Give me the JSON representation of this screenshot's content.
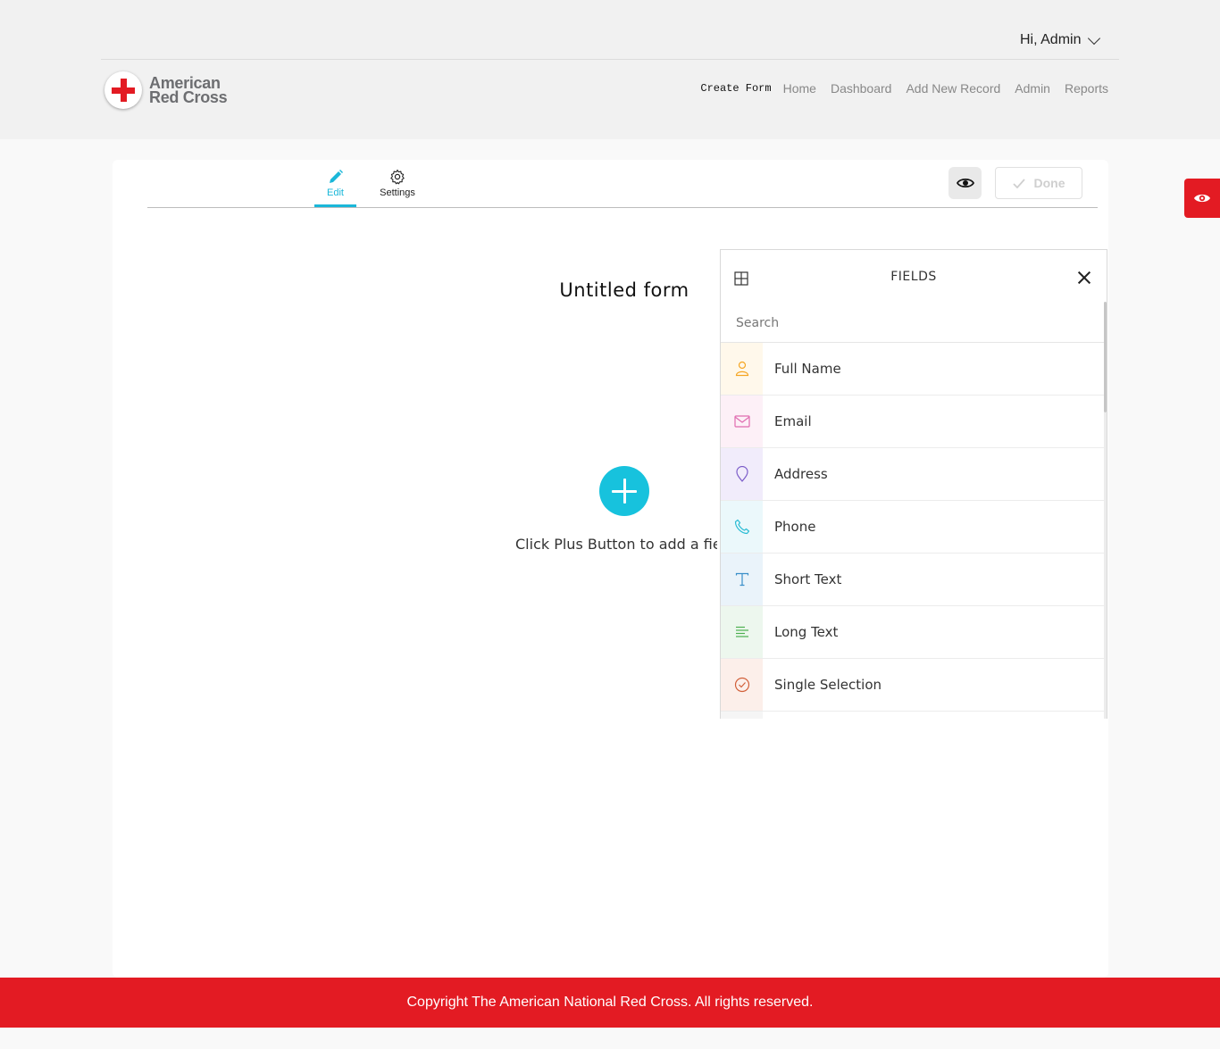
{
  "header": {
    "greeting": "Hi, Admin",
    "logo_line1": "American",
    "logo_line2": "Red Cross",
    "nav": {
      "create_form": "Create Form",
      "home": "Home",
      "dashboard": "Dashboard",
      "add_new_record": "Add New Record",
      "admin": "Admin",
      "reports": "Reports"
    }
  },
  "toolbar": {
    "tab_edit": "Edit",
    "tab_settings": "Settings",
    "done_label": "Done"
  },
  "form": {
    "title": "Untitled form",
    "hint": "Click Plus Button to add a field"
  },
  "fields_panel": {
    "title": "FIELDS",
    "search_placeholder": "Search",
    "items": [
      {
        "label": "Full Name",
        "icon": "person-icon",
        "color": "#f5a623",
        "bg": "#fff8eb"
      },
      {
        "label": "Email",
        "icon": "envelope-icon",
        "color": "#e06bb0",
        "bg": "#fdf0f7"
      },
      {
        "label": "Address",
        "icon": "location-pin-icon",
        "color": "#7b5cc9",
        "bg": "#f1ecfb"
      },
      {
        "label": "Phone",
        "icon": "phone-icon",
        "color": "#2bbcd4",
        "bg": "#ebf8fb"
      },
      {
        "label": "Short Text",
        "icon": "text-icon",
        "color": "#3a8fc9",
        "bg": "#eaf3fa"
      },
      {
        "label": "Long Text",
        "icon": "paragraph-icon",
        "color": "#4caf50",
        "bg": "#edf7ee"
      },
      {
        "label": "Single Selection",
        "icon": "check-circle-icon",
        "color": "#d2603a",
        "bg": "#fcefea"
      }
    ]
  },
  "footer": {
    "copyright": "Copyright The American National Red Cross. All rights reserved."
  },
  "colors": {
    "brand_red": "#e31b23",
    "accent_cyan": "#17c2dd"
  }
}
